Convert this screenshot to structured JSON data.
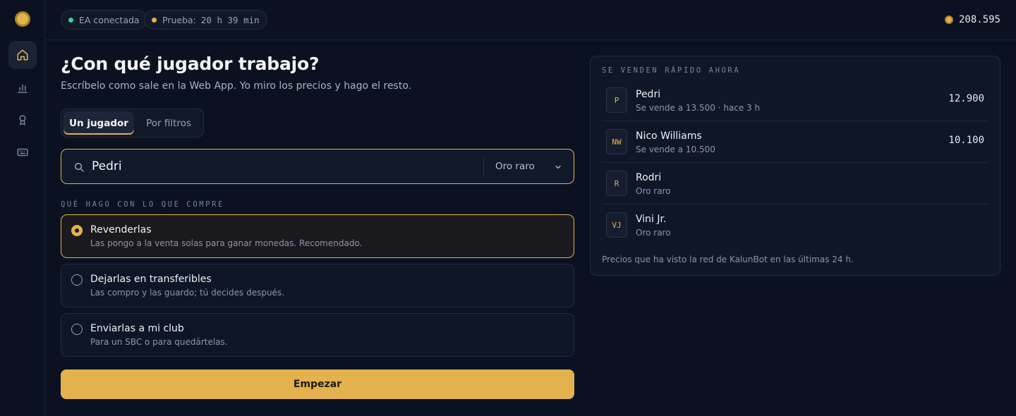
{
  "status": {
    "connection": "EA conectada",
    "trial_label": "Prueba:",
    "trial_time": "20 h 39 min",
    "balance": "208.595",
    "connection_color": "#34d399",
    "trial_color": "#e2b34a"
  },
  "nav": {
    "items": [
      {
        "name": "home-icon",
        "active": true
      },
      {
        "name": "chart-icon",
        "active": false
      },
      {
        "name": "award-icon",
        "active": false
      },
      {
        "name": "keyboard-icon",
        "active": false
      }
    ]
  },
  "main": {
    "title": "¿Con qué jugador trabajo?",
    "subtitle": "Escríbelo como sale en la Web App. Yo miro los precios y hago el resto.",
    "tabs": [
      {
        "label": "Un jugador",
        "active": true
      },
      {
        "label": "Por filtros",
        "active": false
      }
    ],
    "search": {
      "value": "Pedri",
      "quality": "Oro raro"
    },
    "section_label": "QUÉ HAGO CON LO QUE COMPRE",
    "options": [
      {
        "title": "Revenderlas",
        "desc": "Las pongo a la venta solas para ganar monedas. Recomendado.",
        "selected": true
      },
      {
        "title": "Dejarlas en transferibles",
        "desc": "Las compro y las guardo; tú decides después.",
        "selected": false
      },
      {
        "title": "Enviarlas a mi club",
        "desc": "Para un SBC o para quedártelas.",
        "selected": false
      }
    ],
    "start_label": "Empezar"
  },
  "panel": {
    "label": "SE VENDEN RÁPIDO AHORA",
    "rows": [
      {
        "initials": "P",
        "name": "Pedri",
        "sub": "Se vende a 13.500 · hace 3 h",
        "price": "12.900"
      },
      {
        "initials": "NW",
        "name": "Nico Williams",
        "sub": "Se vende a 10.500",
        "price": "10.100"
      },
      {
        "initials": "R",
        "name": "Rodri",
        "sub": "Oro raro",
        "price": ""
      },
      {
        "initials": "VJ",
        "name": "Vini Jr.",
        "sub": "Oro raro",
        "price": ""
      }
    ],
    "footnote": "Precios que ha visto la red de KalunBot en las últimas 24 h."
  }
}
